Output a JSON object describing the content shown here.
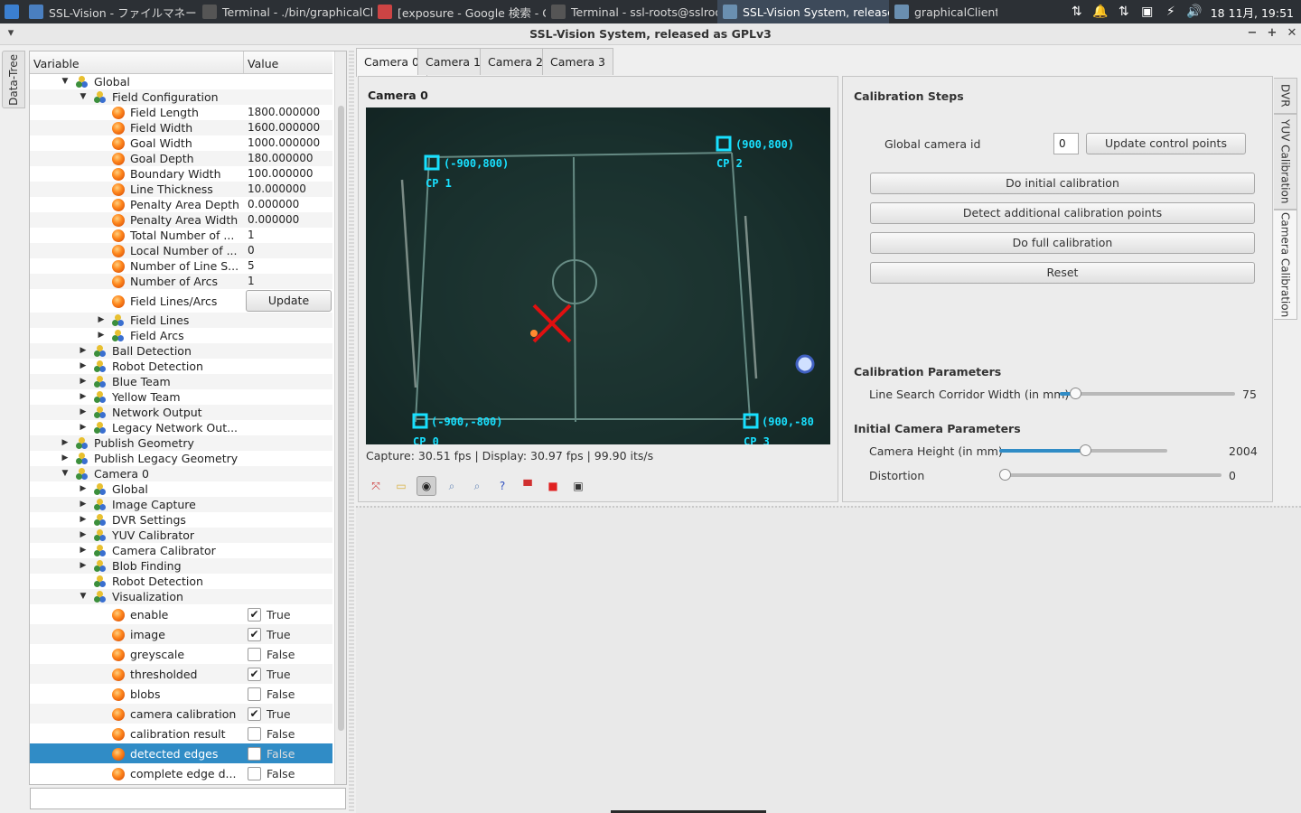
{
  "taskbar": {
    "items": [
      {
        "label": "SSL-Vision - ファイルマネー...",
        "color": "#4a7fc0"
      },
      {
        "label": "Terminal - ./bin/graphicalCli...",
        "color": "#555"
      },
      {
        "label": "[exposure - Google 検索 - G...",
        "color": "#c44"
      },
      {
        "label": "Terminal - ssl-roots@sslroo...",
        "color": "#555"
      },
      {
        "label": "SSL-Vision System, release...",
        "color": "#6a8fb0"
      },
      {
        "label": "graphicalClient",
        "color": "#6a8fb0"
      }
    ],
    "clock": "18 11月, 19:51"
  },
  "window": {
    "title": "SSL-Vision System, released as GPLv3"
  },
  "sidebar_tab": "Data-Tree",
  "tree": {
    "headers": {
      "variable": "Variable",
      "value": "Value"
    },
    "rows": [
      {
        "label": "Global",
        "arrow": "▼",
        "icon": "grp",
        "level": 0
      },
      {
        "label": "Field Configuration",
        "arrow": "▼",
        "icon": "grp",
        "level": 1
      },
      {
        "label": "Field Length",
        "icon": "var",
        "level": 2,
        "value": "1800.000000"
      },
      {
        "label": "Field Width",
        "icon": "var",
        "level": 2,
        "value": "1600.000000"
      },
      {
        "label": "Goal Width",
        "icon": "var",
        "level": 2,
        "value": "1000.000000"
      },
      {
        "label": "Goal Depth",
        "icon": "var",
        "level": 2,
        "value": "180.000000"
      },
      {
        "label": "Boundary Width",
        "icon": "var",
        "level": 2,
        "value": "100.000000"
      },
      {
        "label": "Line Thickness",
        "icon": "var",
        "level": 2,
        "value": "10.000000"
      },
      {
        "label": "Penalty Area Depth",
        "icon": "var",
        "level": 2,
        "value": "0.000000"
      },
      {
        "label": "Penalty Area Width",
        "icon": "var",
        "level": 2,
        "value": "0.000000"
      },
      {
        "label": "Total Number of ...",
        "icon": "var",
        "level": 2,
        "value": "1"
      },
      {
        "label": "Local Number of ...",
        "icon": "var",
        "level": 2,
        "value": "0"
      },
      {
        "label": "Number of Line S...",
        "icon": "var",
        "level": 2,
        "value": "5"
      },
      {
        "label": "Number of Arcs",
        "icon": "var",
        "level": 2,
        "value": "1"
      },
      {
        "label": "Field Lines/Arcs",
        "icon": "var",
        "level": 2,
        "button": "Update"
      },
      {
        "label": "Field Lines",
        "arrow": "▶",
        "icon": "grp",
        "level": 2
      },
      {
        "label": "Field Arcs",
        "arrow": "▶",
        "icon": "grp",
        "level": 2
      },
      {
        "label": "Ball Detection",
        "arrow": "▶",
        "icon": "grp",
        "level": 1
      },
      {
        "label": "Robot Detection",
        "arrow": "▶",
        "icon": "grp",
        "level": 1
      },
      {
        "label": "Blue Team",
        "arrow": "▶",
        "icon": "grp",
        "level": 1
      },
      {
        "label": "Yellow Team",
        "arrow": "▶",
        "icon": "grp",
        "level": 1
      },
      {
        "label": "Network Output",
        "arrow": "▶",
        "icon": "grp",
        "level": 1
      },
      {
        "label": "Legacy Network Out...",
        "arrow": "▶",
        "icon": "grp",
        "level": 1
      },
      {
        "label": "Publish Geometry",
        "arrow": "▶",
        "icon": "grp",
        "level": 0
      },
      {
        "label": "Publish Legacy Geometry",
        "arrow": "▶",
        "icon": "grp",
        "level": 0
      },
      {
        "label": "Camera 0",
        "arrow": "▼",
        "icon": "grp",
        "level": 0
      },
      {
        "label": "Global",
        "arrow": "▶",
        "icon": "grp",
        "level": 1
      },
      {
        "label": "Image Capture",
        "arrow": "▶",
        "icon": "grp",
        "level": 1
      },
      {
        "label": "DVR Settings",
        "arrow": "▶",
        "icon": "grp",
        "level": 1
      },
      {
        "label": "YUV Calibrator",
        "arrow": "▶",
        "icon": "grp",
        "level": 1
      },
      {
        "label": "Camera Calibrator",
        "arrow": "▶",
        "icon": "grp",
        "level": 1
      },
      {
        "label": "Blob Finding",
        "arrow": "▶",
        "icon": "grp",
        "level": 1
      },
      {
        "label": "Robot Detection",
        "icon": "grp",
        "level": 1
      },
      {
        "label": "Visualization",
        "arrow": "▼",
        "icon": "grp",
        "level": 1
      },
      {
        "label": "enable",
        "icon": "var",
        "level": 2,
        "check": true,
        "value": "True"
      },
      {
        "label": "image",
        "icon": "var",
        "level": 2,
        "check": true,
        "value": "True"
      },
      {
        "label": "greyscale",
        "icon": "var",
        "level": 2,
        "check": false,
        "value": "False"
      },
      {
        "label": "thresholded",
        "icon": "var",
        "level": 2,
        "check": true,
        "value": "True"
      },
      {
        "label": "blobs",
        "icon": "var",
        "level": 2,
        "check": false,
        "value": "False"
      },
      {
        "label": "camera calibration",
        "icon": "var",
        "level": 2,
        "check": true,
        "value": "True"
      },
      {
        "label": "calibration result",
        "icon": "var",
        "level": 2,
        "check": false,
        "value": "False"
      },
      {
        "label": "detected edges",
        "icon": "var",
        "level": 2,
        "check": false,
        "value": "False",
        "selected": true
      },
      {
        "label": "complete edge d...",
        "icon": "var",
        "level": 2,
        "check": false,
        "value": "False"
      }
    ]
  },
  "camera_tabs": [
    "Camera 0",
    "Camera 1",
    "Camera 2",
    "Camera 3"
  ],
  "view": {
    "title": "Camera 0",
    "fps": "Capture: 30.51 fps | Display: 30.97 fps | 99.90 its/s",
    "control_points": [
      {
        "coord": "(-900,800)",
        "name": "CP 1"
      },
      {
        "coord": "(900,800)",
        "name": "CP 2"
      },
      {
        "coord": "(-900,-800)",
        "name": "CP 0"
      },
      {
        "coord": "(900,-80",
        "name": "CP 3"
      }
    ]
  },
  "calibration": {
    "steps_title": "Calibration Steps",
    "camera_id_label": "Global camera id",
    "camera_id_value": "0",
    "update_cp_button": "Update control points",
    "initial_button": "Do initial calibration",
    "detect_button": "Detect additional calibration points",
    "full_button": "Do full calibration",
    "reset_button": "Reset",
    "params_title": "Calibration Parameters",
    "corridor_label": "Line Search Corridor Width (in mm)",
    "corridor_value": "75",
    "corridor_fraction": 0.06,
    "initial_title": "Initial Camera Parameters",
    "height_label": "Camera Height (in mm)",
    "height_value": "2004",
    "height_fraction": 0.51,
    "distortion_label": "Distortion",
    "distortion_value": "0",
    "distortion_fraction": 0.0
  },
  "side_tabs": [
    "DVR",
    "YUV Calibration",
    "Camera Calibration"
  ]
}
